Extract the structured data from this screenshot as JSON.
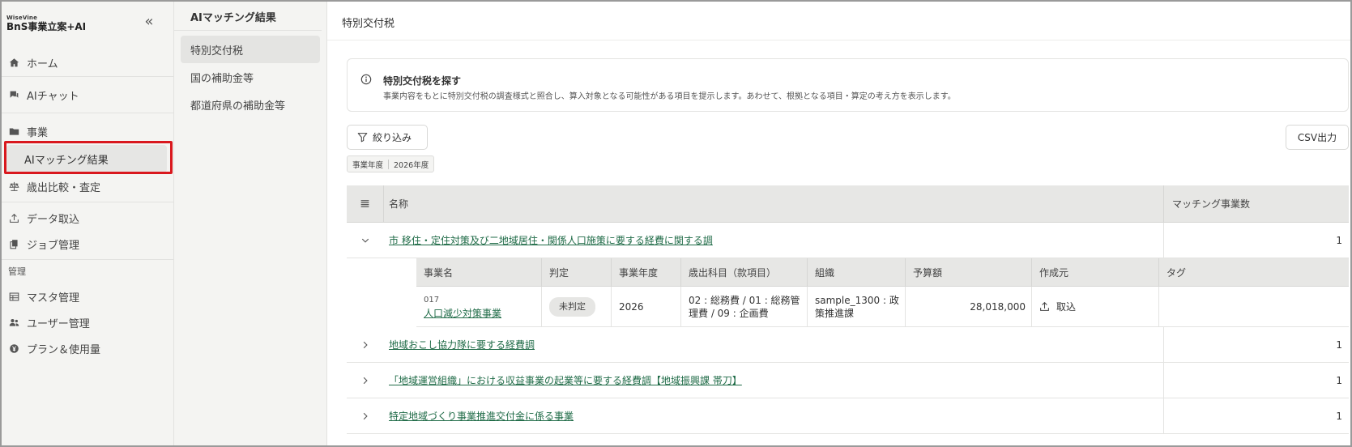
{
  "app": {
    "logo_small": "WiseVine",
    "logo_main": "BnS事業立案+AI",
    "collapse_glyph": "«"
  },
  "sidebar": {
    "items": [
      {
        "label": "ホーム",
        "icon": "home-icon"
      },
      {
        "label": "AIチャット",
        "icon": "chat-icon"
      },
      {
        "label": "事業",
        "icon": "folder-icon"
      }
    ],
    "sub_active": "AIマッチング結果",
    "items2": [
      {
        "label": "歳出比較・査定",
        "icon": "scale-icon"
      },
      {
        "label": "データ取込",
        "icon": "upload-icon"
      },
      {
        "label": "ジョブ管理",
        "icon": "copy-icon"
      }
    ],
    "section_label": "管理",
    "items3": [
      {
        "label": "マスタ管理",
        "icon": "table-icon"
      },
      {
        "label": "ユーザー管理",
        "icon": "users-icon"
      },
      {
        "label": "プラン＆使用量",
        "icon": "yen-icon"
      }
    ]
  },
  "submenu": {
    "title": "AIマッチング結果",
    "items": [
      "特別交付税",
      "国の補助金等",
      "都道府県の補助金等"
    ]
  },
  "main": {
    "header": "特別交付税",
    "info_title": "特別交付税を探す",
    "info_desc": "事業内容をもとに特別交付税の調査様式と照合し、算入対象となる可能性がある項目を提示します。あわせて、根拠となる項目・算定の考え方を表示します。",
    "filter_label": "絞り込み",
    "csv_label": "CSV出力",
    "chip_key": "事業年度",
    "chip_value": "2026年度"
  },
  "table": {
    "headers": {
      "name": "名称",
      "count": "マッチング事業数"
    },
    "rows": [
      {
        "name": "市 移住・定住対策及び二地域居住・関係人口施策に要する経費に関する調",
        "count": "1",
        "expanded": true
      },
      {
        "name": "地域おこし協力隊に要する経費調",
        "count": "1",
        "expanded": false
      },
      {
        "name": "「地域運営組織」における収益事業の起業等に要する経費調【地域振興課 帯刀】",
        "count": "1",
        "expanded": false
      },
      {
        "name": "特定地域づくり事業推進交付金に係る事業",
        "count": "1",
        "expanded": false
      }
    ],
    "sub_headers": [
      "事業名",
      "判定",
      "事業年度",
      "歳出科目（款項目）",
      "組織",
      "予算額",
      "作成元",
      "タグ"
    ],
    "sub_row": {
      "code": "017",
      "name": "人口減少対策事業",
      "judgement": "未判定",
      "year": "2026",
      "account_line1": "02 : 総務費 / 01 : 総務管",
      "account_line2": "理費 / 09 : 企画費",
      "org_line1": "sample_1300 : 政",
      "org_line2": "策推進課",
      "budget": "28,018,000",
      "source": "取込",
      "tag": ""
    }
  },
  "colors": {
    "accent_link": "#1f6b47",
    "highlight": "#d9181e",
    "sidebar_bg": "#f4f4f2"
  }
}
